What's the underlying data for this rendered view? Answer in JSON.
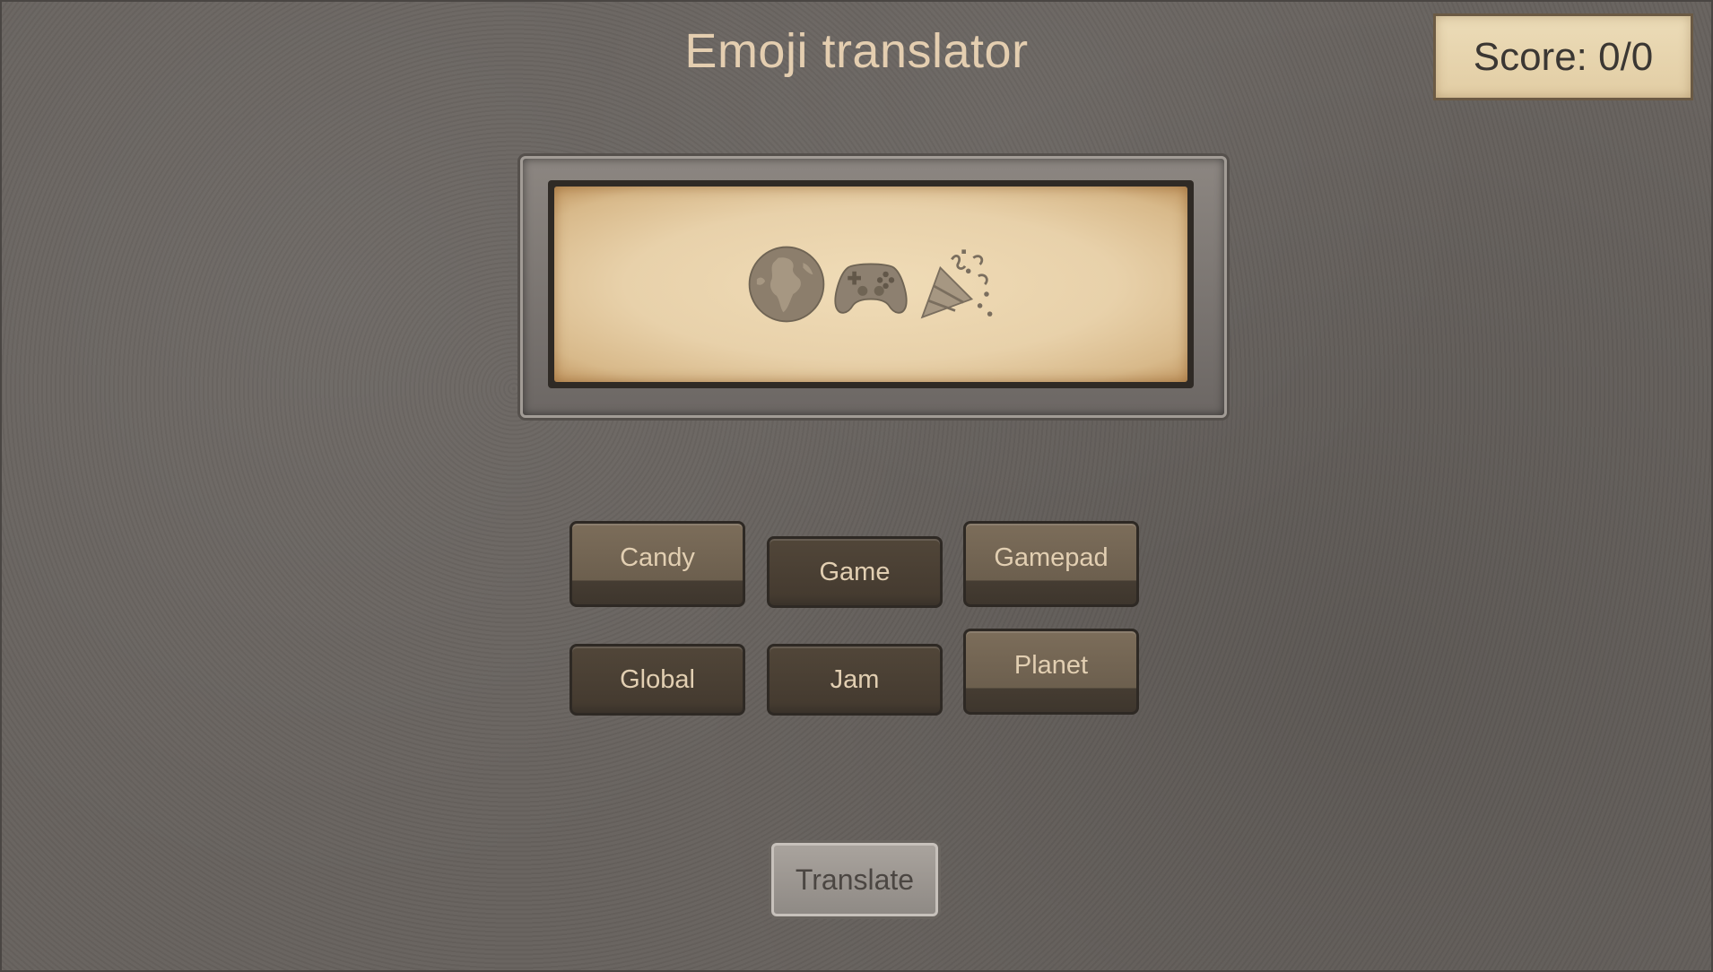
{
  "title": "Emoji translator",
  "score": {
    "text": "Score: 0/0"
  },
  "puzzle": {
    "emojis": [
      "globe-icon",
      "gamepad-icon",
      "party-popper-icon"
    ]
  },
  "choices": [
    "Candy",
    "Game",
    "Gamepad",
    "Global",
    "Jam",
    "Planet"
  ],
  "translate_label": "Translate",
  "colors": {
    "background": "#67625e",
    "title_text": "#e4ceb0",
    "parchment": "#e8d1aa",
    "button": "#6c5f4e",
    "button_text": "#e2cfb2",
    "translate_button": "#8f8a85"
  }
}
